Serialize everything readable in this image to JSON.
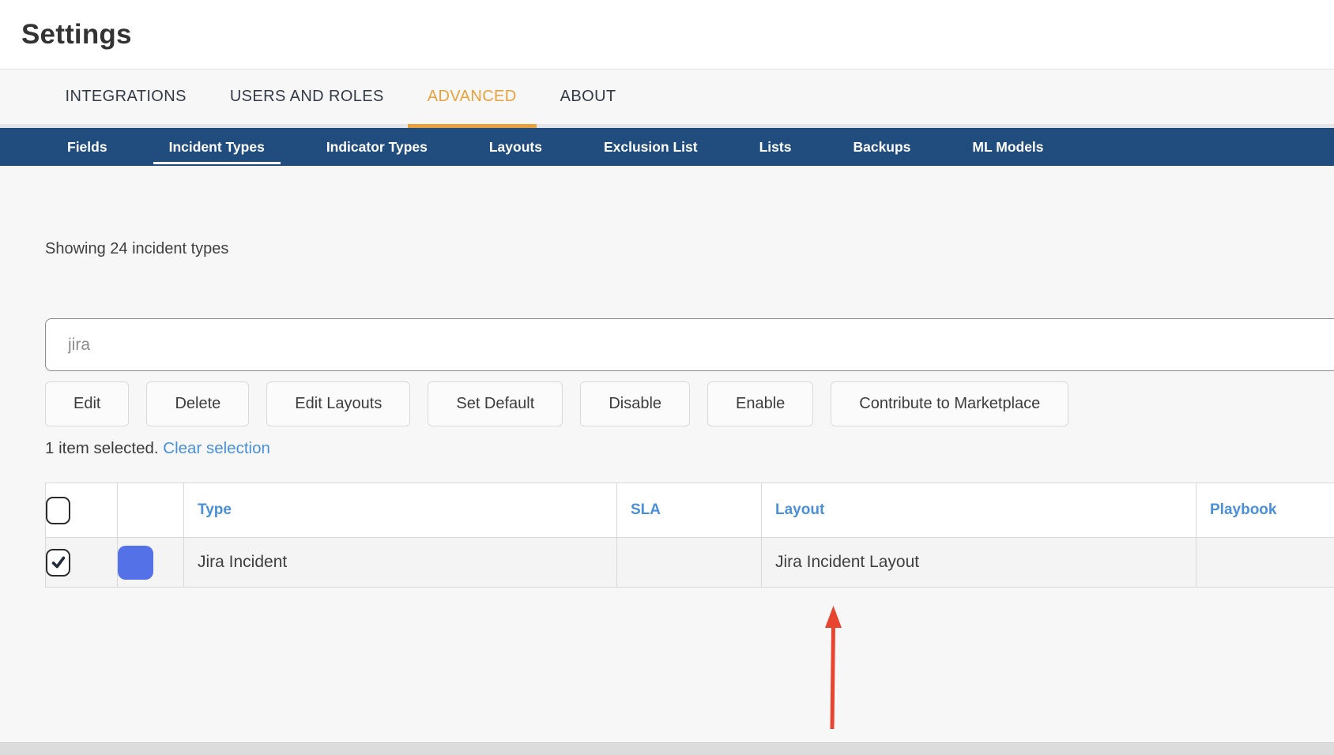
{
  "page": {
    "title": "Settings"
  },
  "tabs": {
    "items": [
      {
        "label": "INTEGRATIONS"
      },
      {
        "label": "USERS AND ROLES"
      },
      {
        "label": "ADVANCED"
      },
      {
        "label": "ABOUT"
      }
    ],
    "active": "ADVANCED"
  },
  "subnav": {
    "items": [
      {
        "label": "Fields"
      },
      {
        "label": "Incident Types"
      },
      {
        "label": "Indicator Types"
      },
      {
        "label": "Layouts"
      },
      {
        "label": "Exclusion List"
      },
      {
        "label": "Lists"
      },
      {
        "label": "Backups"
      },
      {
        "label": "ML Models"
      }
    ],
    "active": "Incident Types"
  },
  "summary": "Showing 24 incident types",
  "search": {
    "value": "jira"
  },
  "toolbar": {
    "buttons": [
      {
        "label": "Edit"
      },
      {
        "label": "Delete"
      },
      {
        "label": "Edit Layouts"
      },
      {
        "label": "Set Default"
      },
      {
        "label": "Disable"
      },
      {
        "label": "Enable"
      },
      {
        "label": "Contribute to Marketplace"
      }
    ]
  },
  "selection": {
    "text": "1 item selected.",
    "clear_label": "Clear selection"
  },
  "table": {
    "columns": [
      {
        "label": "Type"
      },
      {
        "label": "SLA"
      },
      {
        "label": "Layout"
      },
      {
        "label": "Playbook"
      }
    ],
    "rows": [
      {
        "selected": true,
        "color": "#5571e8",
        "type": "Jira Incident",
        "sla": "",
        "layout": "Jira Incident Layout",
        "playbook": ""
      }
    ]
  },
  "colors": {
    "accent_orange": "#e9a23b",
    "subnav_blue": "#204d7d",
    "link_blue": "#4a90d9",
    "row_swatch": "#5571e8",
    "annotation_arrow_red": "#e84530"
  }
}
